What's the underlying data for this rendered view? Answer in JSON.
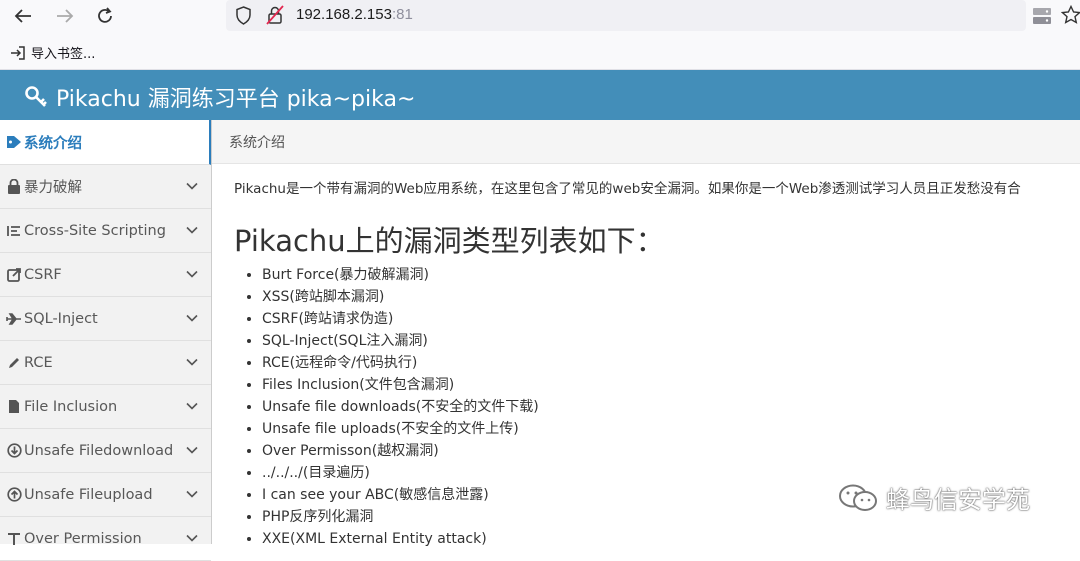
{
  "browser": {
    "url_host": "192.168.2.153",
    "url_port": ":81",
    "bookmark_label": "导入书签..."
  },
  "app": {
    "title": "Pikachu 漏洞练习平台 pika~pika~"
  },
  "sidebar": {
    "items": [
      {
        "label": "系统介绍",
        "icon": "tag-icon"
      },
      {
        "label": "暴力破解",
        "icon": "lock-icon"
      },
      {
        "label": "Cross-Site Scripting",
        "icon": "list-icon"
      },
      {
        "label": "CSRF",
        "icon": "share-icon"
      },
      {
        "label": "SQL-Inject",
        "icon": "plane-icon"
      },
      {
        "label": "RCE",
        "icon": "pencil-icon"
      },
      {
        "label": "File Inclusion",
        "icon": "file-icon"
      },
      {
        "label": "Unsafe Filedownload",
        "icon": "download-icon"
      },
      {
        "label": "Unsafe Fileupload",
        "icon": "upload-icon"
      },
      {
        "label": "Over Permission",
        "icon": "key-icon"
      }
    ]
  },
  "main": {
    "breadcrumb": "系统介绍",
    "intro": "Pikachu是一个带有漏洞的Web应用系统，在这里包含了常见的web安全漏洞。如果你是一个Web渗透测试学习人员且正发愁没有合",
    "heading": "Pikachu上的漏洞类型列表如下：",
    "vulns": [
      "Burt Force(暴力破解漏洞)",
      "XSS(跨站脚本漏洞)",
      "CSRF(跨站请求伪造)",
      "SQL-Inject(SQL注入漏洞)",
      "RCE(远程命令/代码执行)",
      "Files Inclusion(文件包含漏洞)",
      "Unsafe file downloads(不安全的文件下载)",
      "Unsafe file uploads(不安全的文件上传)",
      "Over Permisson(越权漏洞)",
      "../../../(目录遍历)",
      "I can see your ABC(敏感信息泄露)",
      "PHP反序列化漏洞",
      "XXE(XML External Entity attack)"
    ]
  },
  "watermark": {
    "text": "蜂鸟信安学苑"
  },
  "colors": {
    "header_bg": "#438eb9",
    "active_text": "#2b7dbc",
    "sidebar_bg": "#f2f2f2"
  }
}
